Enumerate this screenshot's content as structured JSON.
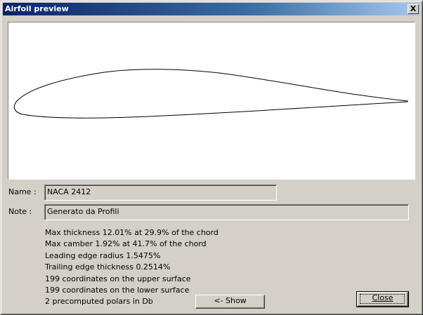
{
  "window": {
    "title": "Airfoil preview",
    "close_glyph": "X"
  },
  "form": {
    "name_label": "Name :",
    "name_value": "NACA 2412",
    "note_label": "Note :",
    "note_value": "Generato da Profili"
  },
  "info": [
    "Max thickness 12.01% at 29.9% of the chord",
    "Max camber 1.92% at 41.7% of the chord",
    "Leading edge radius 1.5475%",
    "Trailing edge thickness 0.2514%",
    "199 coordinates on the upper surface",
    "199 coordinates on the lower surface",
    "2 precomputed polars in Db"
  ],
  "buttons": {
    "show_label": "<- Show",
    "close_label": "Close"
  },
  "colors": {
    "title_start": "#0a246a",
    "title_end": "#a6caf0",
    "face": "#d4d0c8",
    "preview_bg": "#ffffff"
  }
}
